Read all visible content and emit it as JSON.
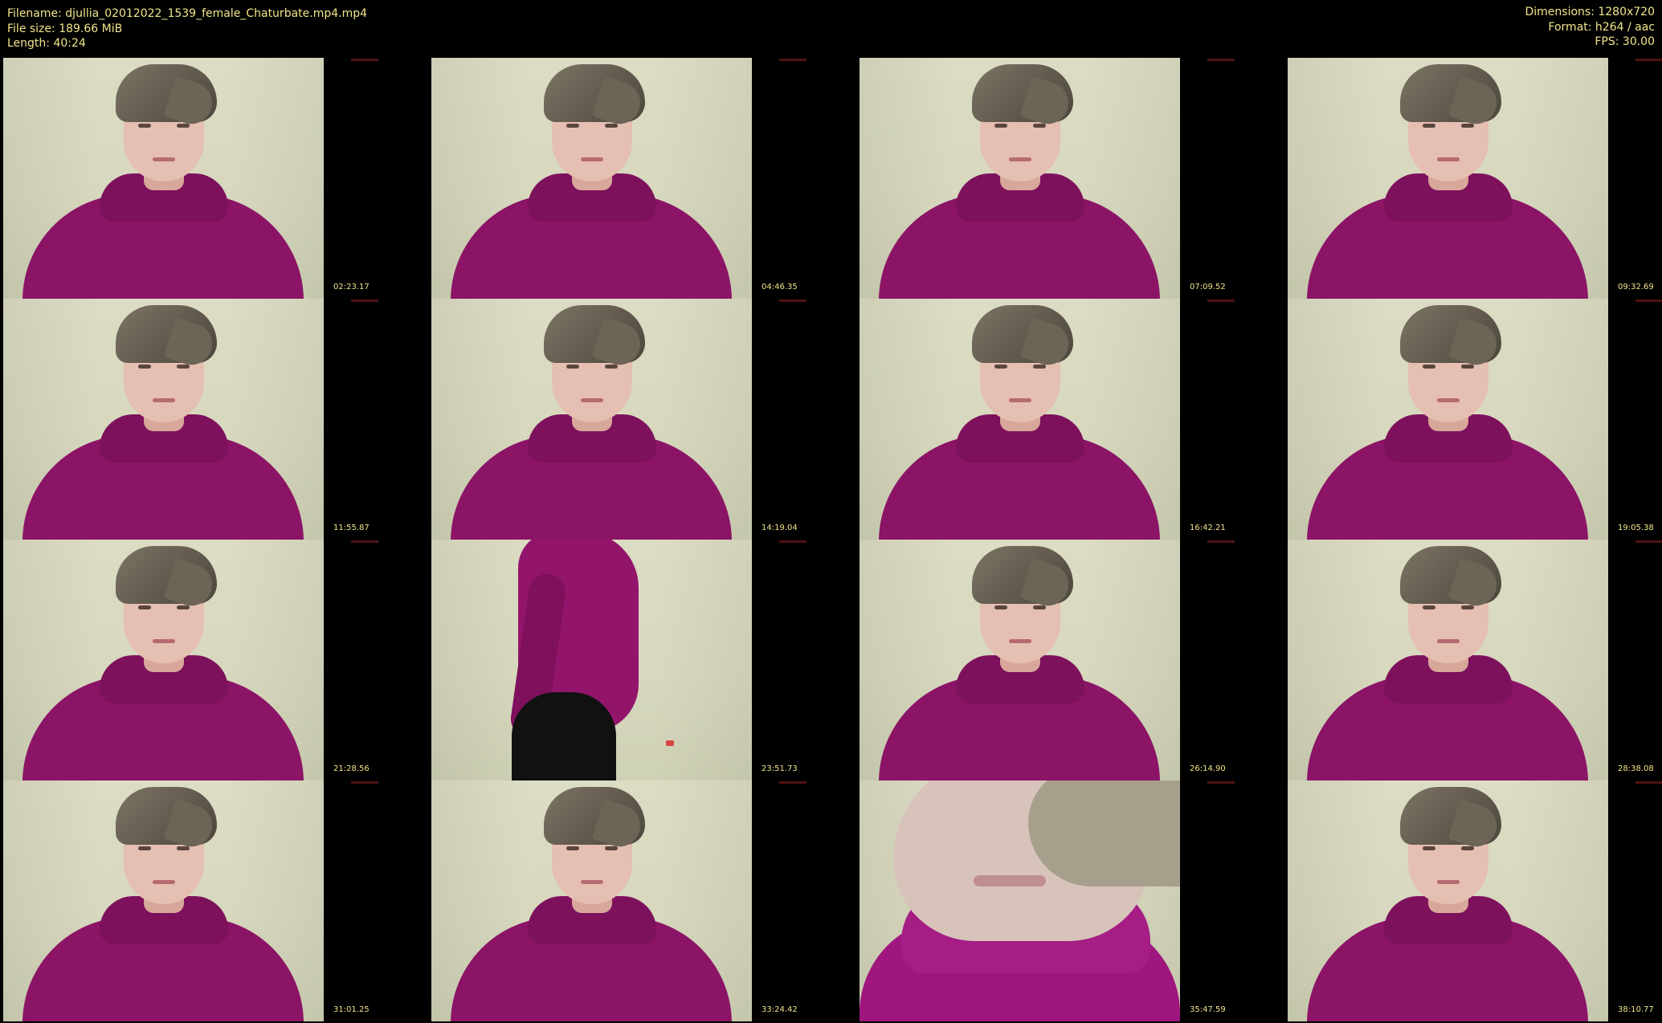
{
  "meta": {
    "filename": "Filename: djullia_02012022_1539_female_Chaturbate.mp4.mp4",
    "file_size": "File size: 189.66 MiB",
    "length": "Length: 40:24",
    "dimensions": "Dimensions: 1280x720",
    "format": "Format: h264 / aac",
    "fps": "FPS: 30.00"
  },
  "thumbnails": [
    {
      "time": "02:23.17",
      "variant": "portrait"
    },
    {
      "time": "04:46.35",
      "variant": "portrait"
    },
    {
      "time": "07:09.52",
      "variant": "portrait"
    },
    {
      "time": "09:32.69",
      "variant": "portrait"
    },
    {
      "time": "11:55.87",
      "variant": "portrait"
    },
    {
      "time": "14:19.04",
      "variant": "portrait"
    },
    {
      "time": "16:42.21",
      "variant": "portrait"
    },
    {
      "time": "19:05.38",
      "variant": "portrait"
    },
    {
      "time": "21:28.56",
      "variant": "portrait"
    },
    {
      "time": "23:51.73",
      "variant": "standing"
    },
    {
      "time": "26:14.90",
      "variant": "portrait"
    },
    {
      "time": "28:38.08",
      "variant": "portrait"
    },
    {
      "time": "31:01.25",
      "variant": "portrait"
    },
    {
      "time": "33:24.42",
      "variant": "portrait"
    },
    {
      "time": "35:47.59",
      "variant": "closeup"
    },
    {
      "time": "38:10.77",
      "variant": "portrait"
    }
  ]
}
